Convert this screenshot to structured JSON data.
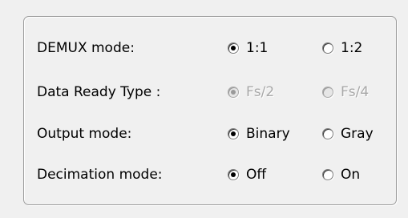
{
  "rows": [
    {
      "label": "DEMUX mode:",
      "enabled": true,
      "options": [
        {
          "label": "1:1",
          "checked": true
        },
        {
          "label": "1:2",
          "checked": false
        }
      ]
    },
    {
      "label": "Data Ready Type :",
      "enabled": false,
      "options": [
        {
          "label": "Fs/2",
          "checked": true
        },
        {
          "label": "Fs/4",
          "checked": false
        }
      ]
    },
    {
      "label": "Output mode:",
      "enabled": true,
      "options": [
        {
          "label": "Binary",
          "checked": true
        },
        {
          "label": "Gray",
          "checked": false
        }
      ]
    },
    {
      "label": "Decimation mode:",
      "enabled": true,
      "options": [
        {
          "label": "Off",
          "checked": true
        },
        {
          "label": "On",
          "checked": false
        }
      ]
    }
  ]
}
